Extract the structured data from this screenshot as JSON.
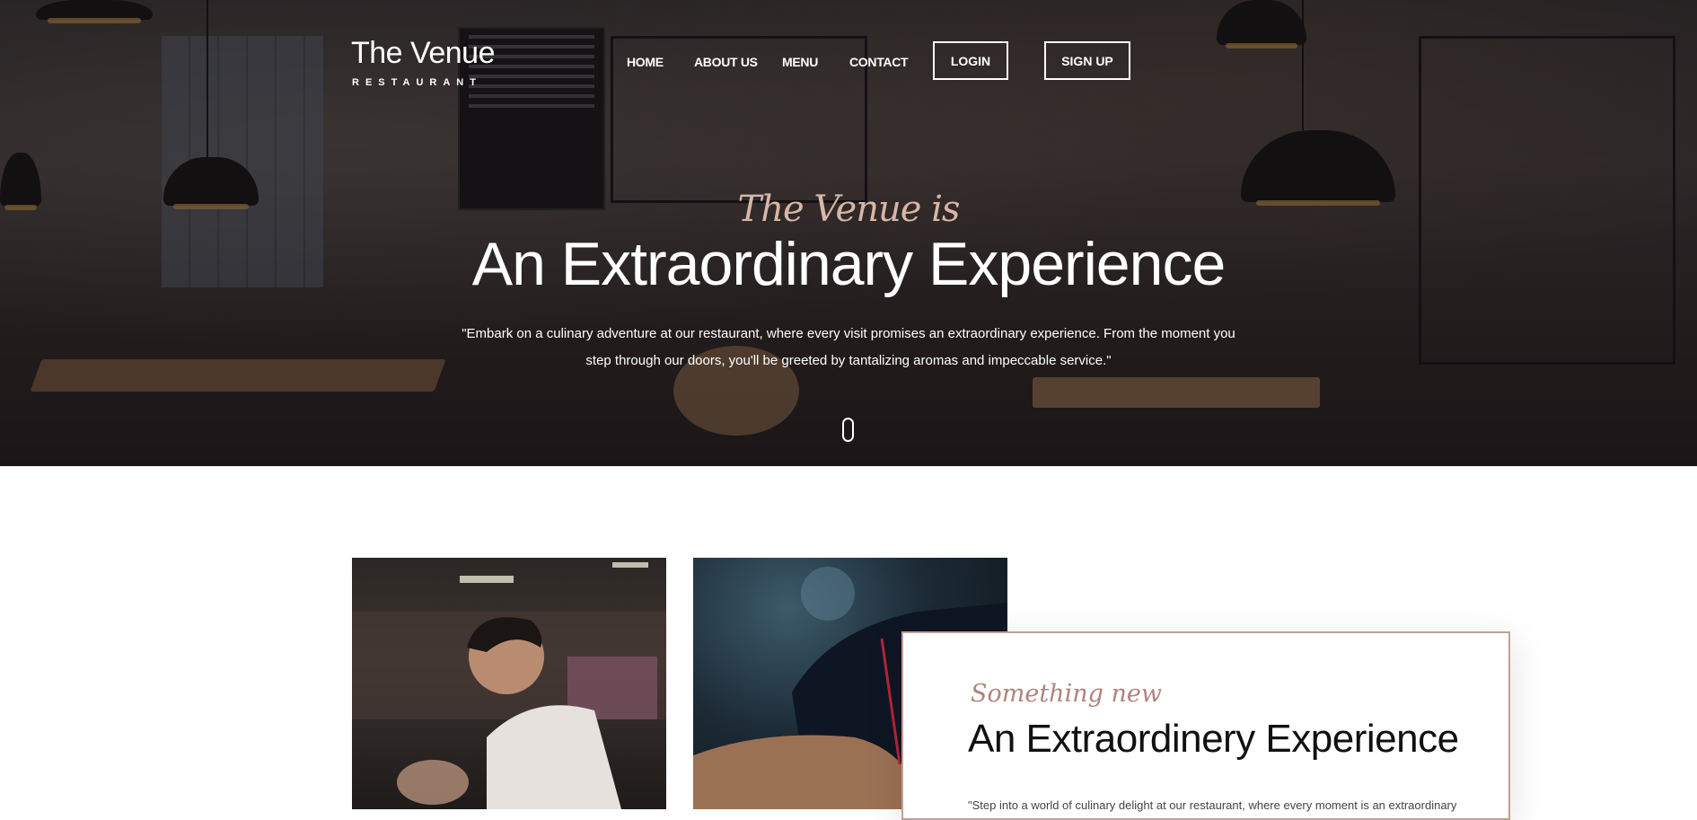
{
  "brand": {
    "name": "The Venue",
    "tagline": "RESTAURANT"
  },
  "nav": {
    "items": [
      {
        "label": "HOME"
      },
      {
        "label": "ABOUT US"
      },
      {
        "label": "MENU"
      },
      {
        "label": "CONTACT"
      }
    ],
    "login_label": "LOGIN",
    "signup_label": "SIGN UP"
  },
  "hero": {
    "script": "The Venue is",
    "title": "An Extraordinary Experience",
    "text": "\"Embark on a culinary adventure at our restaurant, where every visit promises an extraordinary experience. From the moment you step through our doors, you'll be greeted by tantalizing aromas and impeccable service.\""
  },
  "feature": {
    "script": "Something new",
    "title": "An Extraordinery Experience",
    "text": "\"Step into a world of culinary delight at our restaurant, where every moment is an extraordinary"
  },
  "colors": {
    "accent": "#b0837b",
    "card_border": "#c2a096"
  }
}
